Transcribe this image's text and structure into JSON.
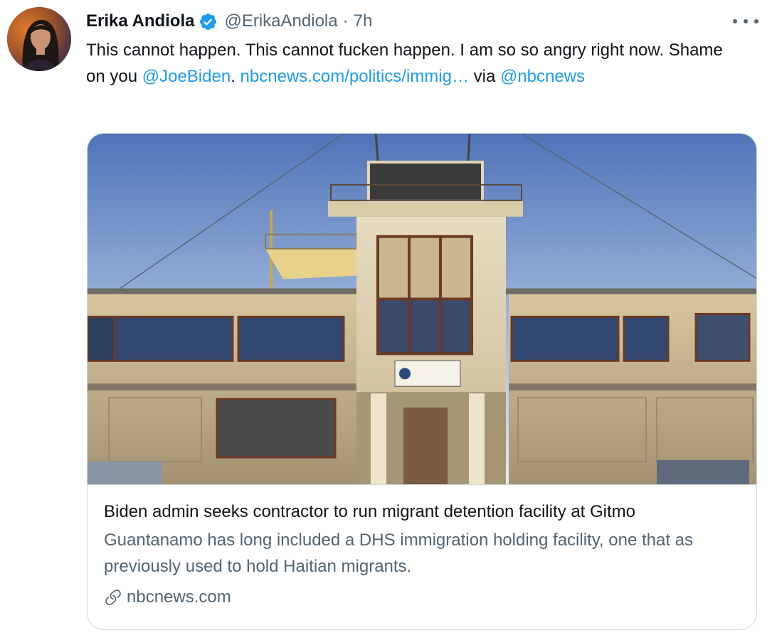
{
  "author": {
    "name": "Erika Andiola",
    "handle": "@ErikaAndiola",
    "separator": "·",
    "time": "7h",
    "verified_icon": "verified-badge-icon",
    "avatar": "avatar"
  },
  "tweet": {
    "text_part1": "This cannot happen. This cannot fucken happen. I am so so angry right now. Shame on you ",
    "mention1": "@JoeBiden",
    "text_part2": ".  ",
    "url": "nbcnews.com/politics/immig…",
    "text_part3": " via ",
    "mention2": "@nbcnews"
  },
  "card": {
    "image": "building-photo",
    "title": "Biden admin seeks contractor to run migrant detention facility at Gitmo",
    "description": "Guantanamo has long included a DHS immigration holding facility, one that as previously used to hold Haitian migrants.",
    "domain": "nbcnews.com",
    "domain_icon": "link-icon"
  },
  "more_icon": "more-options-icon",
  "colors": {
    "link": "#1d9bf0",
    "text": "#0f1419",
    "secondary": "#536471",
    "verified": "#1d9bf0",
    "border": "#cfd9de"
  }
}
